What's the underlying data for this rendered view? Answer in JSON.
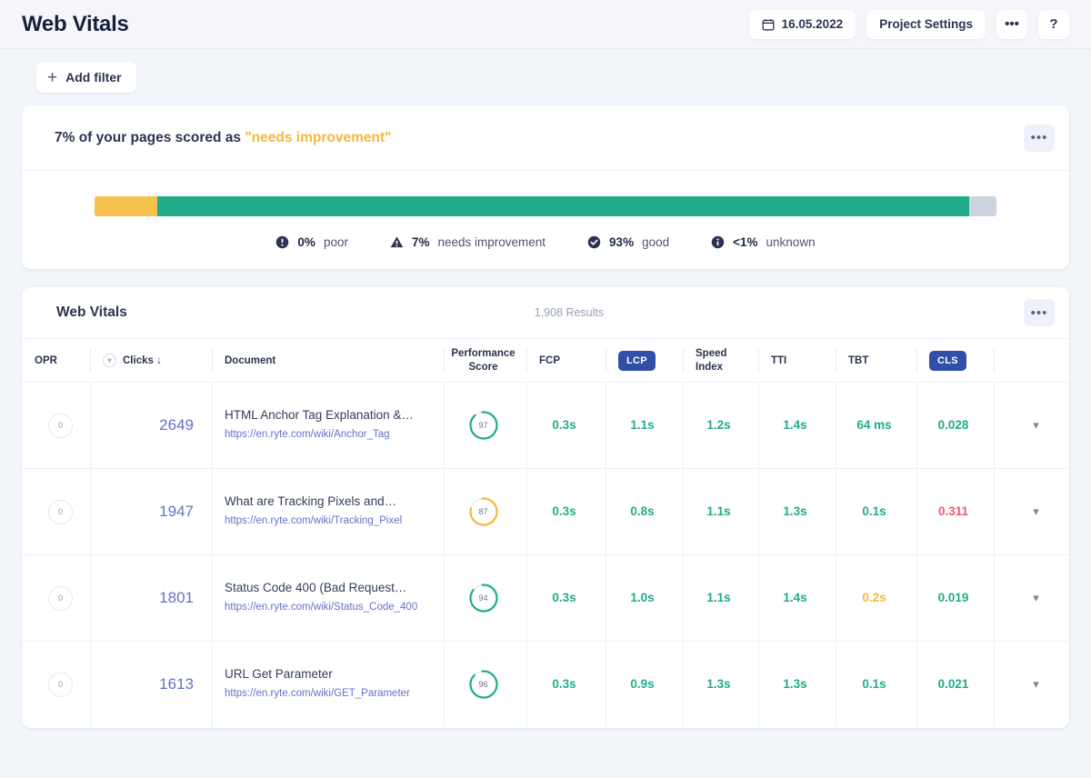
{
  "header": {
    "title": "Web Vitals",
    "date_value": "16.05.2022",
    "calendar_icon": "calendar-icon",
    "project_settings_label": "Project Settings",
    "more_label": "•••",
    "help_label": "?"
  },
  "filters": {
    "add_filter_label": "Add filter",
    "plus_icon": "plus-icon"
  },
  "summary": {
    "lead_text": "7% of your pages scored as ",
    "highlight_text": "\"needs improvement\"",
    "kebab_label": "•••",
    "highlight_color": "#f3b93f",
    "segments": [
      {
        "key": "poor",
        "percent": 0,
        "color": "#e8505b"
      },
      {
        "key": "needs_improvement",
        "percent": 7,
        "color": "#f7c14d"
      },
      {
        "key": "good",
        "percent": 90,
        "color": "#22ab8b"
      },
      {
        "key": "unknown",
        "percent": 3,
        "color": "#ccd4e0"
      }
    ],
    "legend": [
      {
        "icon": "exclamation-circle-icon",
        "value": "0%",
        "label": "poor"
      },
      {
        "icon": "warning-triangle-icon",
        "value": "7%",
        "label": "needs improvement"
      },
      {
        "icon": "check-circle-icon",
        "value": "93%",
        "label": "good"
      },
      {
        "icon": "info-circle-icon",
        "value": "<1%",
        "label": "unknown"
      }
    ]
  },
  "table": {
    "title": "Web Vitals",
    "results_count": "1,908 Results",
    "kebab_label": "•••",
    "columns": [
      {
        "label": "OPR",
        "kind": "text"
      },
      {
        "label": "Clicks ↓",
        "kind": "sort"
      },
      {
        "label": "Document",
        "kind": "text"
      },
      {
        "label": "Performance Score",
        "kind": "two-line"
      },
      {
        "label": "FCP",
        "kind": "text"
      },
      {
        "label": "LCP",
        "kind": "pill"
      },
      {
        "label": "Speed Index",
        "kind": "two-line"
      },
      {
        "label": "TTI",
        "kind": "text"
      },
      {
        "label": "TBT",
        "kind": "text"
      },
      {
        "label": "CLS",
        "kind": "pill"
      },
      {
        "label": "",
        "kind": "blank"
      }
    ],
    "pill_color": "#2f4fa8",
    "rows": [
      {
        "opr": "0",
        "clicks": "2649",
        "doc_title": "HTML Anchor Tag Explanation &…",
        "doc_url": "https://en.ryte.com/wiki/Anchor_Tag",
        "score": "97",
        "score_state": "good",
        "fcp": "0.3s",
        "fcp_state": "good",
        "lcp": "1.1s",
        "lcp_state": "good",
        "speed_index": "1.2s",
        "speed_index_state": "good",
        "tti": "1.4s",
        "tti_state": "good",
        "tbt": "64 ms",
        "tbt_state": "good",
        "cls": "0.028",
        "cls_state": "good",
        "expand_icon": "chevron-down-icon"
      },
      {
        "opr": "0",
        "clicks": "1947",
        "doc_title": "What are Tracking Pixels and…",
        "doc_url": "https://en.ryte.com/wiki/Tracking_Pixel",
        "score": "87",
        "score_state": "needs_improvement",
        "fcp": "0.3s",
        "fcp_state": "good",
        "lcp": "0.8s",
        "lcp_state": "good",
        "speed_index": "1.1s",
        "speed_index_state": "good",
        "tti": "1.3s",
        "tti_state": "good",
        "tbt": "0.1s",
        "tbt_state": "good",
        "cls": "0.311",
        "cls_state": "poor",
        "expand_icon": "chevron-down-icon"
      },
      {
        "opr": "0",
        "clicks": "1801",
        "doc_title": "Status Code 400 (Bad Request…",
        "doc_url": "https://en.ryte.com/wiki/Status_Code_400",
        "score": "94",
        "score_state": "good",
        "fcp": "0.3s",
        "fcp_state": "good",
        "lcp": "1.0s",
        "lcp_state": "good",
        "speed_index": "1.1s",
        "speed_index_state": "good",
        "tti": "1.4s",
        "tti_state": "good",
        "tbt": "0.2s",
        "tbt_state": "needs_improvement",
        "cls": "0.019",
        "cls_state": "good",
        "expand_icon": "chevron-down-icon"
      },
      {
        "opr": "0",
        "clicks": "1613",
        "doc_title": "URL Get Parameter",
        "doc_url": "https://en.ryte.com/wiki/GET_Parameter",
        "score": "96",
        "score_state": "good",
        "fcp": "0.3s",
        "fcp_state": "good",
        "lcp": "0.9s",
        "lcp_state": "good",
        "speed_index": "1.3s",
        "speed_index_state": "good",
        "tti": "1.3s",
        "tti_state": "good",
        "tbt": "0.1s",
        "tbt_state": "good",
        "cls": "0.021",
        "cls_state": "good",
        "expand_icon": "chevron-down-icon"
      }
    ]
  }
}
